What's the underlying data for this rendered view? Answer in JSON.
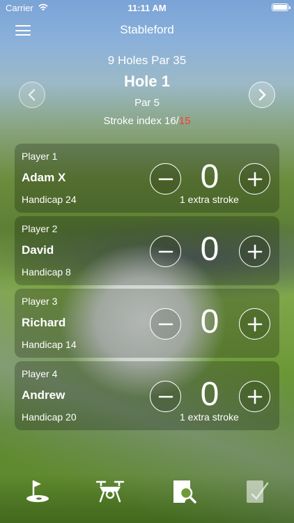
{
  "status_bar": {
    "carrier": "Carrier",
    "time": "11:11 AM"
  },
  "nav": {
    "title": "Stableford"
  },
  "hole_info": {
    "course": "9 Holes Par 35",
    "hole": "Hole 1",
    "par": "Par 5",
    "stroke_index_label": "Stroke index 16/",
    "stroke_index_total": "15"
  },
  "players": [
    {
      "label": "Player 1",
      "name": "Adam X",
      "handicap": "Handicap 24",
      "score": "0",
      "extra": "1 extra stroke"
    },
    {
      "label": "Player 2",
      "name": "David",
      "handicap": "Handicap 8",
      "score": "0",
      "extra": ""
    },
    {
      "label": "Player 3",
      "name": "Richard",
      "handicap": "Handicap 14",
      "score": "0",
      "extra": ""
    },
    {
      "label": "Player 4",
      "name": "Andrew",
      "handicap": "Handicap 20",
      "score": "0",
      "extra": "1 extra stroke"
    }
  ],
  "tab_bar": {
    "items": [
      "golf-flag-icon",
      "drone-icon",
      "search-document-icon",
      "scorecard-check-icon"
    ]
  },
  "colors": {
    "accent_red": "#ff3b30"
  }
}
